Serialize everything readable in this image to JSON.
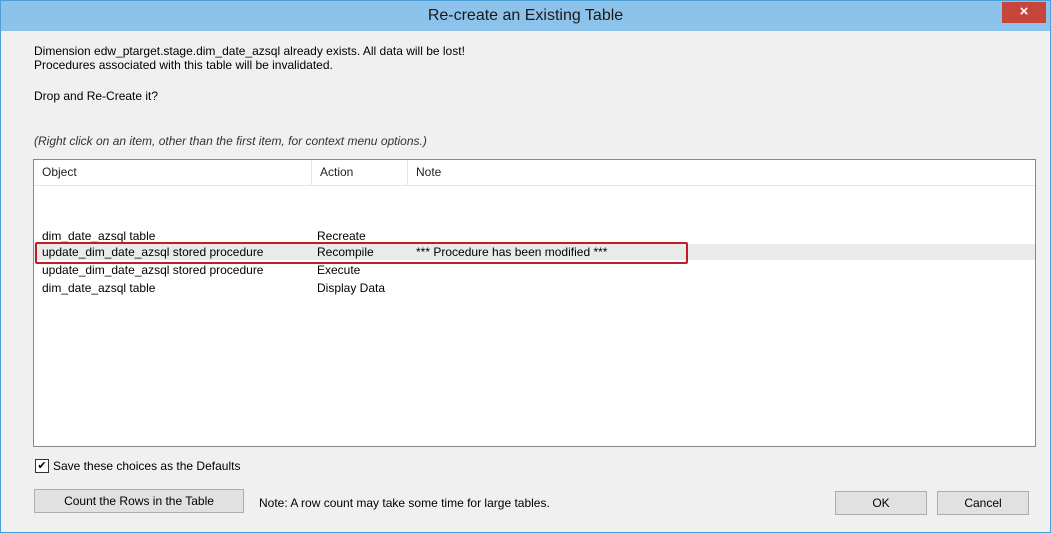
{
  "window": {
    "title": "Re-create an Existing Table",
    "close_glyph": "×"
  },
  "message": {
    "line1": "Dimension edw_ptarget.stage.dim_date_azsql already exists. All data will be lost!",
    "line2": "Procedures associated with this table will be invalidated.",
    "question": "Drop and Re-Create it?",
    "hint": "(Right click on an item, other than the first item, for context menu options.)"
  },
  "table": {
    "columns": [
      "Object",
      "Action",
      "Note"
    ],
    "rows": [
      {
        "object": "dim_date_azsql table",
        "action": "Recreate",
        "note": ""
      },
      {
        "object": "update_dim_date_azsql stored procedure",
        "action": "Recompile",
        "note": "*** Procedure has been modified ***"
      },
      {
        "object": "update_dim_date_azsql stored procedure",
        "action": "Execute",
        "note": ""
      },
      {
        "object": "dim_date_azsql table",
        "action": "Display Data",
        "note": ""
      }
    ]
  },
  "options": {
    "save_defaults_label": "Save these choices as the Defaults",
    "save_defaults_checked": true,
    "check_glyph": "✔"
  },
  "footer": {
    "count_button": "Count the Rows in the Table",
    "note": "Note: A row count may take some time for large tables.",
    "ok_button": "OK",
    "cancel_button": "Cancel"
  },
  "colors": {
    "titlebar": "#8dc3ea",
    "close": "#c7463c",
    "highlight": "#c11d27"
  },
  "icons": {
    "close": "close-icon",
    "check": "checkmark-icon"
  }
}
